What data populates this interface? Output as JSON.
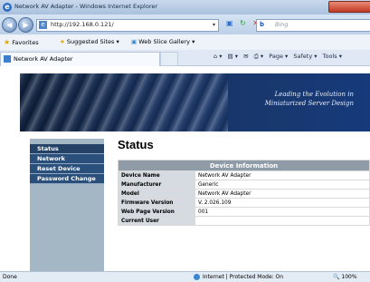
{
  "window": {
    "title": "Network AV Adapter - Windows Internet Explorer"
  },
  "address_bar": {
    "url": "http://192.168.0.121/"
  },
  "search": {
    "placeholder": "Bing"
  },
  "favorites": {
    "label": "Favorites",
    "items": [
      {
        "label": "Suggested Sites ▾"
      },
      {
        "label": "Web Slice Gallery ▾"
      }
    ]
  },
  "tab": {
    "label": "Network AV Adapter"
  },
  "command_bar": {
    "page": "Page ▾",
    "safety": "Safety ▾",
    "tools": "Tools ▾"
  },
  "banner": {
    "slogan": "Leading the Evolution in\nMiniaturized Server Design"
  },
  "sidebar": {
    "items": [
      {
        "label": "Status"
      },
      {
        "label": "Network"
      },
      {
        "label": "Reset Device"
      },
      {
        "label": "Password Change"
      }
    ]
  },
  "main": {
    "title": "Status",
    "table_title": "Device Information",
    "rows": [
      {
        "label": "Device Name",
        "value": "Network AV Adapter"
      },
      {
        "label": "Manufacturer",
        "value": "Generic"
      },
      {
        "label": "Model",
        "value": "Network AV Adapter"
      },
      {
        "label": "Firmware Version",
        "value": "V. 2.026.109"
      },
      {
        "label": "Web Page Version",
        "value": "001"
      },
      {
        "label": "Current User",
        "value": ""
      }
    ]
  },
  "status_bar": {
    "left": "Done",
    "zone": "Internet | Protected Mode: On",
    "zoom": "100%"
  },
  "colors": {
    "menu_bg": "#2a4f7a",
    "sidebar_bg": "#a4b7c5",
    "table_header": "#8f9ca8",
    "label_cell": "#d5dbe0"
  }
}
